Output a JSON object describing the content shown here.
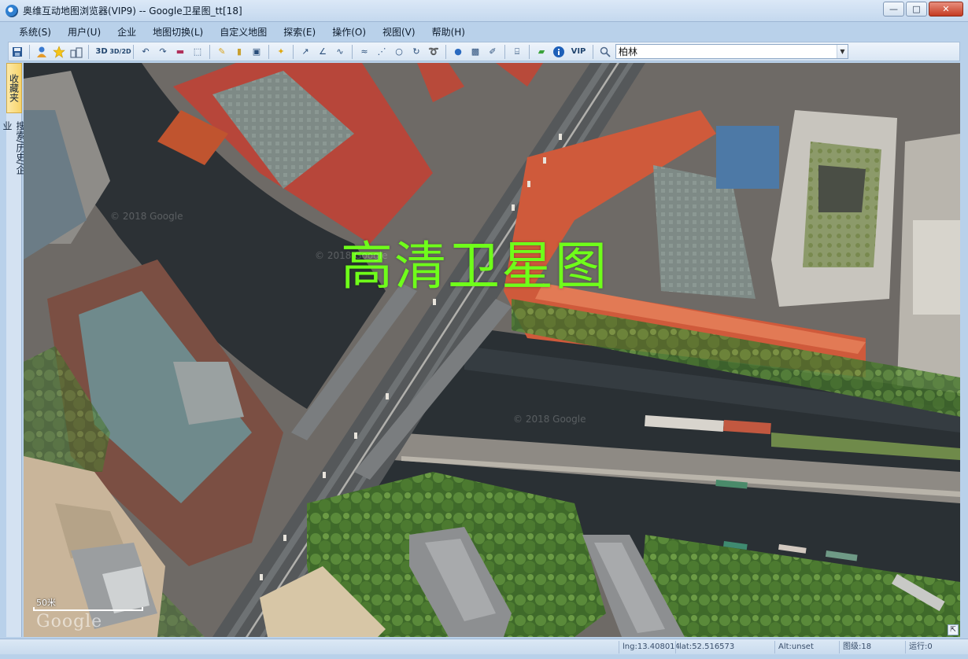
{
  "window": {
    "title": "奥维互动地图浏览器(VIP9) -- Google卫星图_tt[18]",
    "btn_minimize": "—",
    "btn_restore": "□",
    "btn_close": "✕"
  },
  "menu": {
    "items": [
      "系统(S)",
      "用户(U)",
      "企业",
      "地图切换(L)",
      "自定义地图",
      "探索(E)",
      "操作(O)",
      "视图(V)",
      "帮助(H)"
    ]
  },
  "toolbar": {
    "label_3d": "3D",
    "label_3d2d": "3D/2D",
    "label_vip": "VIP",
    "search_value": "柏林",
    "icons": [
      "save-icon",
      "user-icon",
      "star-icon",
      "buildings-icon",
      "undo-icon",
      "redo-icon",
      "delete-icon",
      "select-icon",
      "ruler-icon",
      "frame-icon",
      "marker-icon",
      "line-icon",
      "angle-icon",
      "curve-icon",
      "road-icon",
      "dots-icon",
      "circle-icon",
      "rotate-icon",
      "lasso-icon",
      "globe-icon",
      "layer-icon",
      "pen-icon",
      "print-icon",
      "chat-icon",
      "info-icon",
      "magnifier-icon"
    ]
  },
  "side_panel": {
    "tab_favorites": "收藏夹",
    "tab_search": "搜索/历史/企业"
  },
  "map": {
    "overlay_text": "高清卫星图",
    "watermark_1": "© 2018 Google",
    "watermark_2": "© 2018 Google",
    "watermark_3": "© 2018 Google",
    "scale_label": "50米",
    "logo": "Google"
  },
  "status": {
    "lng": "lng:13.408014",
    "lat": "lat:52.516573",
    "alt": "Alt:unset",
    "level": "图级:18",
    "run": "运行:0"
  }
}
